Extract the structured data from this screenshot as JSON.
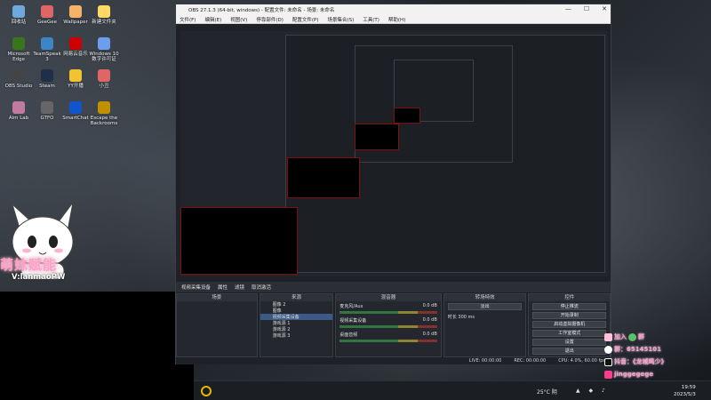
{
  "desktop": {
    "icons": [
      {
        "label": "回收站",
        "color": "#6fa8dc"
      },
      {
        "label": "GeeGee",
        "color": "#e06666"
      },
      {
        "label": "Wallpaper",
        "color": "#f6b26b"
      },
      {
        "label": "新建文件夹",
        "color": "#ffd966"
      },
      {
        "label": "Microsoft Edge",
        "color": "#38761d"
      },
      {
        "label": "TeamSpeak 3",
        "color": "#3d85c6"
      },
      {
        "label": "网易云音乐",
        "color": "#cc0000"
      },
      {
        "label": "Windows 10 数字许可证",
        "color": "#6d9eeb"
      },
      {
        "label": "OBS Studio",
        "color": "#444444"
      },
      {
        "label": "Steam",
        "color": "#1f2f4a"
      },
      {
        "label": "YY开播",
        "color": "#f1c232"
      },
      {
        "label": "小丑",
        "color": "#e06666"
      },
      {
        "label": "Aim Lab",
        "color": "#c27ba0"
      },
      {
        "label": "GTFO",
        "color": "#666666"
      },
      {
        "label": "SmartChat",
        "color": "#1155cc"
      },
      {
        "label": "Escape the Backrooms",
        "color": "#bf9000"
      }
    ],
    "mascot_text": "萌妹赋能",
    "mascot_sub": "V:lanmaoPW"
  },
  "obs": {
    "title": "OBS 27.1.3 (64-bit, windows) - 配置文件: 未命名 - 场景: 未命名",
    "menu": [
      "文件(F)",
      "编辑(E)",
      "视图(V)",
      "停靠部件(D)",
      "配置文件(P)",
      "场景集合(S)",
      "工具(T)",
      "帮助(H)"
    ],
    "source_bar": {
      "name": "视频采集设备",
      "props": "属性",
      "filter": "滤镜",
      "deactivate": "取消激活"
    },
    "docks": {
      "scenes": "场景",
      "sources": "来源",
      "mixer": "混音器",
      "transitions": "转场特效",
      "controls": "控件"
    },
    "sources": [
      "图像 2",
      "图像",
      "视频采集设备",
      "游戏源 1",
      "游戏源 2",
      "游戏源 3"
    ],
    "mixer": [
      {
        "name": "麦克风/Aux",
        "db": "0.0 dB"
      },
      {
        "name": "视频采集设备",
        "db": "0.0 dB"
      },
      {
        "name": "桌面音频",
        "db": "0.0 dB"
      }
    ],
    "transition": {
      "type": "淡出",
      "duration_label": "时长",
      "duration": "300 ms"
    },
    "controls": [
      "停止推流",
      "开始录制",
      "启动虚拟摄像机",
      "工作室模式",
      "设置",
      "退出"
    ],
    "status": {
      "live": "LIVE: 00:00:00",
      "rec": "REC: 00:00:00",
      "cpu": "CPU: 4.0%, 60.00 fps"
    }
  },
  "taskbar": {
    "weather": "25°C 阴",
    "time": "19:59",
    "date": "2023/5/3"
  },
  "overlay": {
    "join": "加入",
    "group": "群",
    "qq": "群：65145101",
    "douyin": "抖音：《龙城鸣少》",
    "tiktok": "jinggegege"
  }
}
